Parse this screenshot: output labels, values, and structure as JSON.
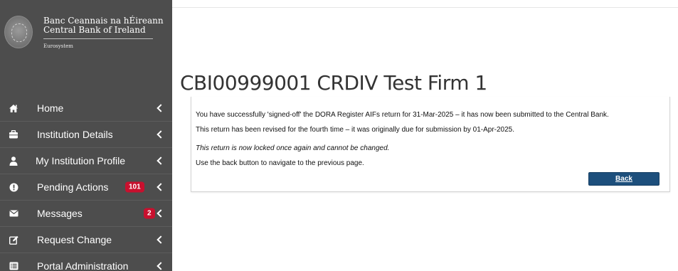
{
  "brand": {
    "name_ga": "Banc Ceannais na hÉireann",
    "name_en": "Central Bank of Ireland",
    "tagline": "Eurosystem"
  },
  "sidebar": {
    "items": [
      {
        "label": "Home",
        "icon": "home-icon"
      },
      {
        "label": "Institution Details",
        "icon": "briefcase-icon"
      },
      {
        "label": "My Institution Profile",
        "icon": "user-icon"
      },
      {
        "label": "Pending Actions",
        "icon": "exclamation-circle-icon",
        "badge": "101"
      },
      {
        "label": "Messages",
        "icon": "envelope-icon",
        "badge": "2"
      },
      {
        "label": "Request Change",
        "icon": "edit-icon"
      },
      {
        "label": "Portal Administration",
        "icon": "list-icon"
      }
    ]
  },
  "main": {
    "title": "CBI00999001 CRDIV Test Firm 1",
    "messages": [
      "You have successfully 'signed-off' the DORA Register AIFs return for 31-Mar-2025 – it has now been submitted to the Central Bank.",
      "This return has been revised for the fourth time – it was originally due for submission by 01-Apr-2025.",
      "This return is now locked once again and cannot be changed.",
      "Use the back button to navigate to the previous page."
    ],
    "back_label": "Back"
  },
  "colors": {
    "sidebar_bg": "#4d4d4d",
    "badge": "#c8102e",
    "button": "#1d4f7c"
  }
}
